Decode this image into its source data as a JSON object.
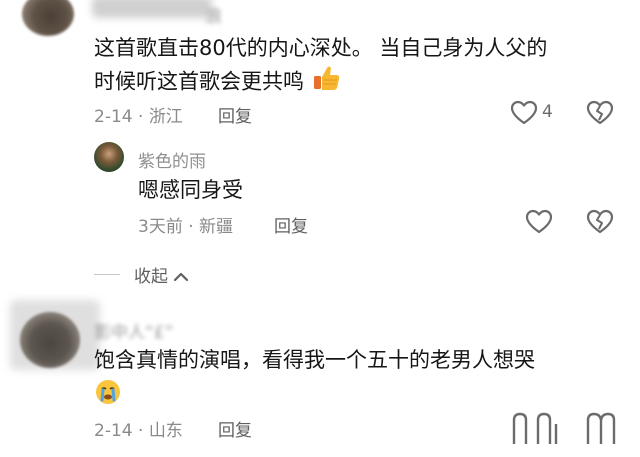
{
  "comment1": {
    "name": "浪",
    "text_line1": "这首歌直击80代的内心深处。 当自己身为人父的",
    "text_line2": "时候听这首歌会更共鸣",
    "emoji": "thumbs-up-icon",
    "date": "2-14",
    "location": "浙江",
    "reply_label": "回复",
    "like_count": "4"
  },
  "reply1": {
    "name": "紫色的雨",
    "text": "嗯感同身受",
    "date": "3天前",
    "location": "新疆",
    "reply_label": "回复"
  },
  "collapse": {
    "label": "收起"
  },
  "comment2": {
    "name": "影中人“£”",
    "text": "饱含真情的演唱，看得我一个五十的老男人想哭",
    "emoji": "crying-face-icon",
    "date": "2-14",
    "location": "山东",
    "reply_label": "回复"
  },
  "separator": "·"
}
